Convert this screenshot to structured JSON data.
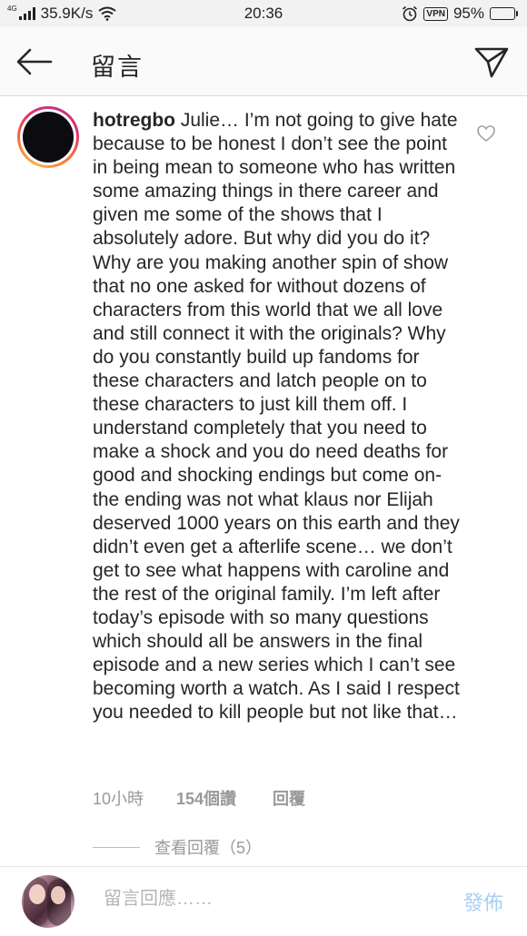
{
  "status_bar": {
    "network_type": "4G",
    "speed": "35.9K/s",
    "time": "20:36",
    "vpn_label": "VPN",
    "battery_text": "95%",
    "battery_level": 0.95,
    "battery_color": "#4cd964"
  },
  "header": {
    "title": "留言",
    "back_icon": "arrow-left-icon",
    "send_icon": "paper-plane-icon"
  },
  "comment": {
    "username": "hotregbo",
    "text": "Julie… I’m not going to give hate because to be honest I don’t see the point in being mean to someone who has written some amazing things in there career and given me some of the shows that I absolutely adore. But why did you do it? Why are you making another  spin of show that no one asked for without dozens of characters from this world that we all love and still connect it with the originals? Why do you constantly build up fandoms for these characters and latch people on to these characters to just kill them off. I understand completely that you need to make a shock and you do need deaths for good and shocking endings but come on- the ending was not what klaus nor Elijah deserved 1000 years on this earth and they didn’t even get a afterlife scene… we don’t get to see what happens with caroline and the rest of the original family. I’m left after today’s episode with so many questions which should all be answers in the final episode and a new series which I can’t see becoming worth a watch. As I said I respect you needed to kill people but not like that…",
    "time_ago": "10小時",
    "likes": "154個讚",
    "reply_label": "回覆",
    "view_replies": "查看回覆（5）",
    "avatar_ring_colors": [
      "#fcaf45",
      "#f77737",
      "#e1306c",
      "#c13584"
    ]
  },
  "composer": {
    "placeholder": "留言回應……",
    "post_label": "發佈",
    "post_color": "#a9cdf2"
  }
}
